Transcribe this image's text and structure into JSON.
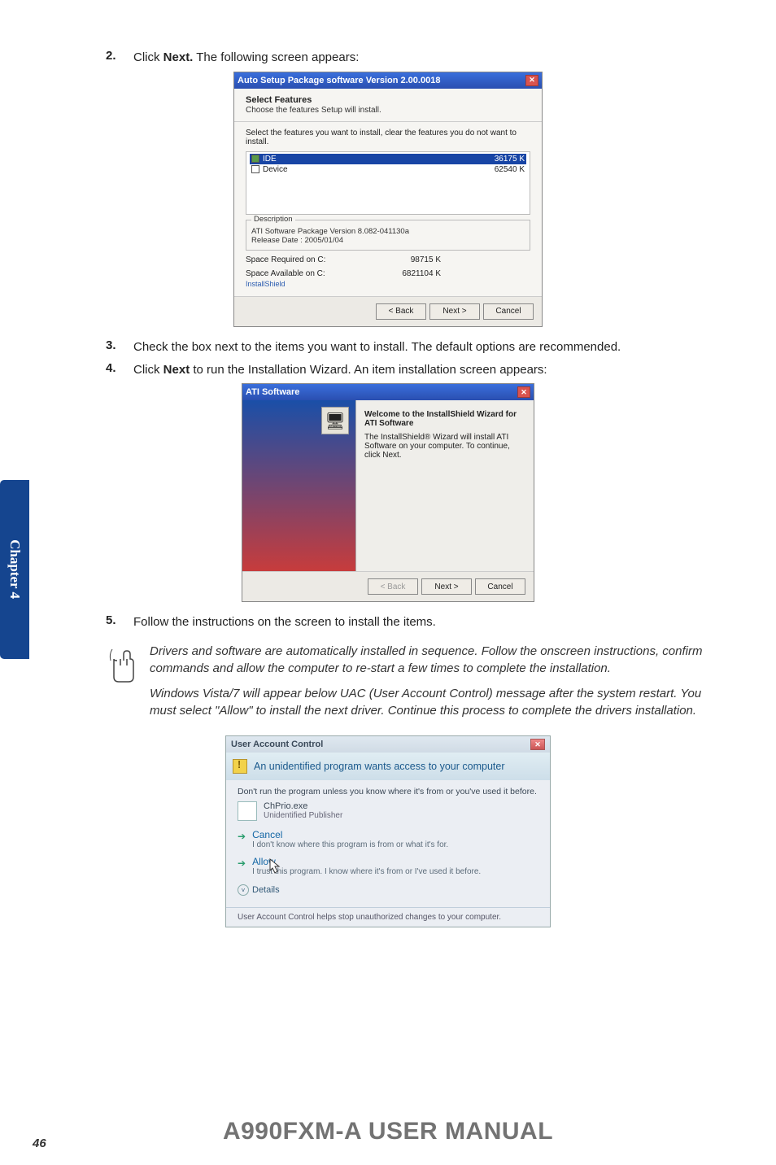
{
  "steps": {
    "s2": {
      "num": "2.",
      "prefix": "Click ",
      "bold": "Next.",
      "suffix": " The following screen appears:"
    },
    "s3": {
      "num": "3.",
      "text": "Check the box next to the items you want to install. The default options are recommended."
    },
    "s4": {
      "num": "4.",
      "prefix": "Click ",
      "bold": "Next",
      "suffix": " to run the Installation Wizard. An item installation screen appears:"
    },
    "s5": {
      "num": "5.",
      "text": "Follow the instructions on the screen to install the items."
    }
  },
  "dialog_setup": {
    "title": "Auto Setup Package software Version 2.00.0018",
    "h1": "Select Features",
    "sub": "Choose the features Setup will install.",
    "instr": "Select the features you want to install, clear the features you do not want to install.",
    "features": [
      {
        "name": "IDE",
        "size": "36175 K",
        "selected": true
      },
      {
        "name": "Device",
        "size": "62540 K",
        "selected": false
      }
    ],
    "desc_legend": "Description",
    "desc_line1": "ATI Software Package Version 8.082-041130a",
    "desc_line2": "Release Date : 2005/01/04",
    "space_req_label": "Space Required on  C:",
    "space_req_val": "98715 K",
    "space_av_label": "Space Available on  C:",
    "space_av_val": "6821104 K",
    "is_brand": "InstallShield",
    "btn_back": "< Back",
    "btn_next": "Next >",
    "btn_cancel": "Cancel"
  },
  "dialog_ati": {
    "title": "ATI Software",
    "welcome": "Welcome to the InstallShield Wizard for ATI Software",
    "body": "The InstallShield® Wizard will install ATI Software on your computer.  To continue, click Next.",
    "btn_back": "< Back",
    "btn_next": "Next >",
    "btn_cancel": "Cancel"
  },
  "note": {
    "p1": "Drivers and software are automatically installed in sequence. Follow the onscreen instructions, confirm commands and allow the computer to re-start a few times to complete the installation.",
    "p2": "Windows Vista/7 will appear below UAC (User Account Control) message after the system restart. You must select \"Allow\" to install the next driver. Continue this process to complete the drivers installation."
  },
  "uac": {
    "title": "User Account Control",
    "banner": "An unidentified program wants access to your computer",
    "warn": "Don't run the program unless you know where it's from or you've used it before.",
    "prog_name": "ChPrio.exe",
    "prog_pub": "Unidentified Publisher",
    "opt_cancel": "Cancel",
    "opt_cancel_sub": "I don't know where this program is from or what it's for.",
    "opt_allow": "Allow",
    "opt_allow_sub": "I trust this program. I know where it's from or I've used it before.",
    "details": "Details",
    "footer": "User Account Control helps stop unauthorized changes to your computer."
  },
  "side_tab": "Chapter 4",
  "footer_manual": "A990FXM-A USER MANUAL",
  "page_number": "46"
}
